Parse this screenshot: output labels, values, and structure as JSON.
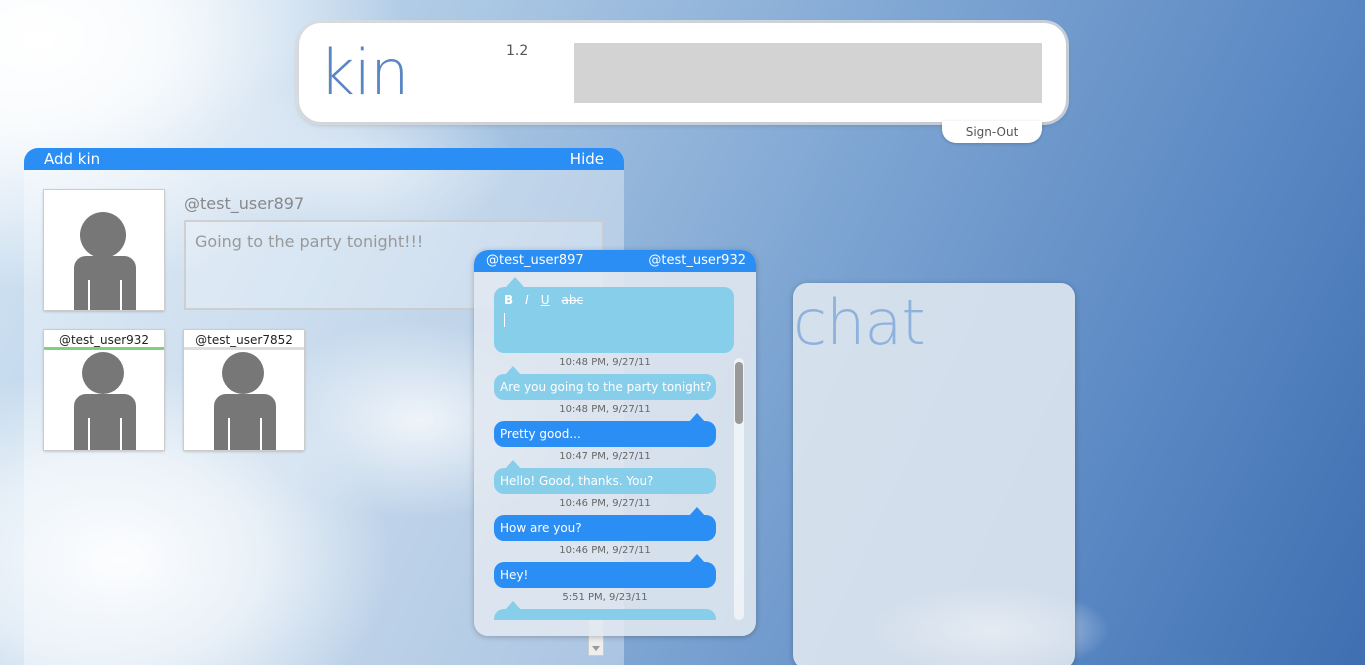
{
  "header": {
    "logo_kin": "kin",
    "logo_chat": "chat",
    "version": "1.2",
    "sign_out": "Sign-Out"
  },
  "kin_panel": {
    "add_kin": "Add kin",
    "hide": "Hide",
    "profile_name": "@test_user897",
    "status": "Going to the party tonight!!!",
    "friends": [
      {
        "name": "@test_user932",
        "status": "online"
      },
      {
        "name": "@test_user7852",
        "status": "offline"
      }
    ]
  },
  "chat": {
    "me": "@test_user897",
    "other": "@test_user932",
    "format": {
      "bold": "B",
      "italic": "I",
      "underline": "U",
      "strike": "abc"
    },
    "messages": [
      {
        "time": "10:48 PM, 9/27/11",
        "text": "Are you going to the party tonight?",
        "direction": "in"
      },
      {
        "time": "10:48 PM, 9/27/11",
        "text": "Pretty good...",
        "direction": "out"
      },
      {
        "time": "10:47 PM, 9/27/11",
        "text": "Hello! Good, thanks. You?",
        "direction": "in"
      },
      {
        "time": "10:46 PM, 9/27/11",
        "text": "How are you?",
        "direction": "out"
      },
      {
        "time": "10:46 PM, 9/27/11",
        "text": "Hey!",
        "direction": "out"
      },
      {
        "time": "5:51 PM, 9/23/11",
        "text": "",
        "direction": "in"
      }
    ]
  },
  "colors": {
    "accent": "#2a8ef5",
    "bubble_in": "#87ceeb",
    "online": "#7fd07f"
  }
}
